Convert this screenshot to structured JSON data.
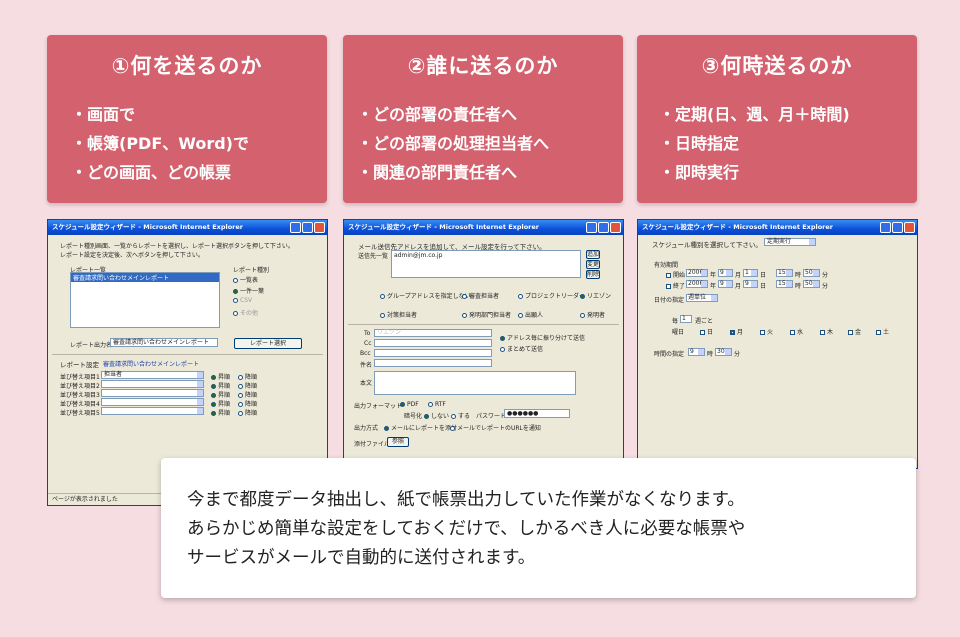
{
  "cards": [
    {
      "title": "①何を送るのか",
      "items": [
        "画面で",
        "帳簿(PDF、Word)で",
        "どの画面、どの帳票"
      ]
    },
    {
      "title": "②誰に送るのか",
      "items": [
        "どの部署の責任者へ",
        "どの部署の処理担当者へ",
        "関連の部門責任者へ"
      ]
    },
    {
      "title": "③何時送るのか",
      "items": [
        "定期(日、週、月＋時間)",
        "日時指定",
        "即時実行"
      ]
    }
  ],
  "win1": {
    "title": "スケジュール設定ウィザード - Microsoft Internet Explorer",
    "intro1": "レポート種別画面、一覧からレポートを選択し、レポート選択ボタンを押して下さい。",
    "intro2": "レポート設定を決定後、次へボタンを押して下さい。",
    "list_label": "レポート一覧",
    "list_item": "審査請求問い合わせメインレポート",
    "kind_label": "レポート種別",
    "kinds": [
      "一覧表",
      "一件一葉",
      "CSV",
      "その他"
    ],
    "output_label": "レポート出力名",
    "output_value": "審査請求問い合わせメインレポート",
    "select_button": "レポート選択",
    "settings_label": "レポート設定",
    "settings_value": "審査請求問い合わせメインレポート",
    "sort_rows": [
      {
        "label": "並び替え項目1",
        "value": "担当者"
      },
      {
        "label": "並び替え項目2",
        "value": ""
      },
      {
        "label": "並び替え項目3",
        "value": ""
      },
      {
        "label": "並び替え項目4",
        "value": ""
      },
      {
        "label": "並び替え項目5",
        "value": ""
      }
    ],
    "asc": "昇順",
    "desc": "降順",
    "status": "ページが表示されました"
  },
  "win2": {
    "title": "スケジュール設定ウィザード - Microsoft Internet Explorer",
    "intro": "メール送信先アドレスを追加して、メール設定を行って下さい。",
    "to_label": "送信先一覧",
    "to_value": "admin@jm.co.jp",
    "add": "追加",
    "change": "変更",
    "delete": "削除",
    "radios1": [
      "グループアドレスを指定しない",
      "審査担当者",
      "プロジェクトリーダー",
      "リエゾン"
    ],
    "radios2": [
      "対策担当者",
      "発明部門担当者",
      "出願人",
      "発明者"
    ],
    "fields": [
      "To",
      "Cc",
      "Bcc",
      "件名",
      "本文"
    ],
    "to_field_value": "リエゾン",
    "split1": "アドレス毎に振り分けて送信",
    "split2": "まとめて送信",
    "format_label": "出力フォーマット",
    "pdf": "PDF",
    "rtf": "RTF",
    "encrypt_label": "暗号化",
    "no": "しない",
    "yes": "する",
    "password_label": "パスワード",
    "password": "●●●●●●",
    "method_label": "出力方式",
    "method1": "メールにレポートを添付",
    "method2": "メールでレポートのURLを通知",
    "attach_label": "添付ファイル",
    "attach_button": "参照"
  },
  "win3": {
    "title": "スケジュール設定ウィザード - Microsoft Internet Explorer",
    "intro": "スケジュール種別を選択して下さい。",
    "type_value": "定期実行",
    "period_label": "有効期間",
    "start": "開始",
    "end": "終了",
    "start_values": [
      "2006",
      "9",
      "1",
      "15",
      "50"
    ],
    "end_values": [
      "2006",
      "9",
      "9",
      "15",
      "50"
    ],
    "units": [
      "年",
      "月",
      "日",
      "時",
      "分"
    ],
    "day_label": "日付の指定",
    "day_value": "週単位",
    "every_prefix": "毎",
    "every_value": "1",
    "every_suffix": "週ごと",
    "weekday_label": "曜日",
    "weekdays": [
      "日",
      "月",
      "火",
      "水",
      "木",
      "金",
      "土"
    ],
    "time_label": "時間の指定",
    "time_hour": "9",
    "time_min": "30",
    "hour_unit": "時",
    "min_unit": "分"
  },
  "note": {
    "line1": "今まで都度データ抽出し、紙で帳票出力していた作業がなくなります。",
    "line2": "あらかじめ簡単な設定をしておくだけで、しかるべき人に必要な帳票や",
    "line3": "サービスがメールで自動的に送付されます。"
  }
}
